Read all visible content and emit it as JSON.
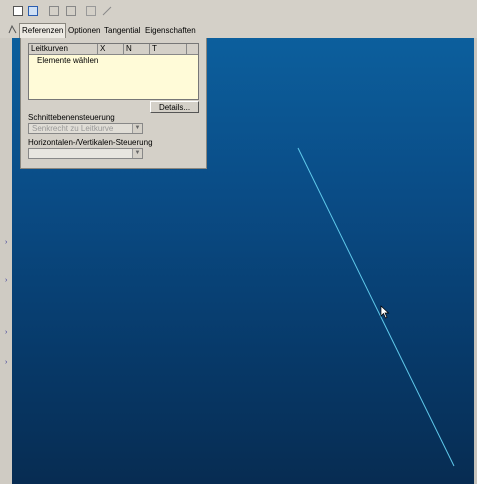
{
  "tabs": [
    {
      "label": "Referenzen",
      "active": true
    },
    {
      "label": "Optionen",
      "active": false
    },
    {
      "label": "Tangential",
      "active": false
    },
    {
      "label": "Eigenschaften",
      "active": false
    }
  ],
  "panel": {
    "table": {
      "columns": [
        "Leitkurven",
        "X",
        "N",
        "T"
      ],
      "rows": [
        "Elemente wählen"
      ]
    },
    "details_button": "Details...",
    "section_label": "Schnittebenensteuerung",
    "section_select_value": "Senkrecht zu Leitkurve",
    "hv_label": "Horizontalen-/Vertikalen-Steuerung",
    "hv_select_value": ""
  },
  "viewport": {
    "curve_color": "#5fc8ea",
    "background_top": "#0c5f9d",
    "background_bottom": "#072c52"
  }
}
